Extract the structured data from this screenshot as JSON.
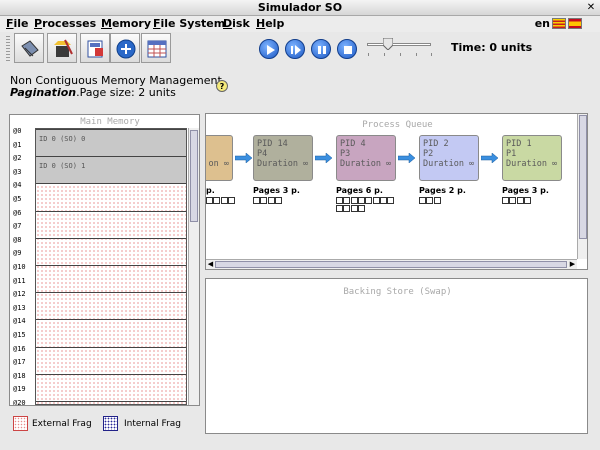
{
  "window": {
    "title": "Simulador SO"
  },
  "menubar": {
    "items": [
      {
        "label": "File",
        "mnemonic": "F"
      },
      {
        "label": "Processes",
        "mnemonic": "P"
      },
      {
        "label": "Memory",
        "mnemonic": "M"
      },
      {
        "label": "File System",
        "mnemonic": "F"
      },
      {
        "label": "Disk",
        "mnemonic": "D"
      },
      {
        "label": "Help",
        "mnemonic": "H"
      }
    ],
    "language": "en",
    "flags": [
      "catalan-flag",
      "spanish-flag"
    ]
  },
  "toolbar": {
    "tools": [
      "memory-config-icon",
      "clean-icon",
      "process-info-icon",
      "add-process-icon",
      "calendar-icon"
    ],
    "controls": [
      "play-icon",
      "step-icon",
      "pause-icon",
      "stop-icon"
    ],
    "speed_level": 0.33,
    "time": "Time: 0 units"
  },
  "mode": {
    "line1": "Non Contiguous Memory Management.",
    "line2_strong": "Pagination",
    "line2_rest": ".Page size: 2 units"
  },
  "memory": {
    "title": "Main Memory",
    "addresses": [
      "@0",
      "@1",
      "@2",
      "@3",
      "@4",
      "@5",
      "@6",
      "@7",
      "@8",
      "@9",
      "@10",
      "@11",
      "@12",
      "@13",
      "@14",
      "@15",
      "@16",
      "@17",
      "@18",
      "@19",
      "@20"
    ],
    "frames": [
      {
        "label": "ID 0 (SO) 0",
        "occupied": true
      },
      {
        "label": "ID 0 (SO) 1",
        "occupied": true
      },
      {
        "label": "",
        "occupied": false
      },
      {
        "label": "",
        "occupied": false
      },
      {
        "label": "",
        "occupied": false
      },
      {
        "label": "",
        "occupied": false
      },
      {
        "label": "",
        "occupied": false
      },
      {
        "label": "",
        "occupied": false
      },
      {
        "label": "",
        "occupied": false
      },
      {
        "label": "",
        "occupied": false
      },
      {
        "label": "",
        "occupied": false
      }
    ]
  },
  "legend": {
    "external": "External Frag",
    "internal": "Internal Frag"
  },
  "queue": {
    "title": "Process Queue",
    "processes": [
      {
        "line1": "",
        "line2": "",
        "line3": "on ∞",
        "color": "#ddc08f",
        "pages_label": "p.",
        "pages": 4
      },
      {
        "line1": "PID 14",
        "line2": "P4",
        "line3": "Duration ∞",
        "color": "#b0b09d",
        "pages_label": "Pages 3 p.",
        "pages": 4
      },
      {
        "line1": "PID 4",
        "line2": "P3",
        "line3": "Duration ∞",
        "color": "#c8a5c0",
        "pages_label": "Pages 6 p.",
        "pages": 12
      },
      {
        "line1": "PID 2",
        "line2": "P2",
        "line3": "Duration ∞",
        "color": "#c3c9f3",
        "pages_label": "Pages 2 p.",
        "pages": 3
      },
      {
        "line1": "PID 1",
        "line2": "P1",
        "line3": "Duration ∞",
        "color": "#c9d9a3",
        "pages_label": "Pages 3 p.",
        "pages": 4
      }
    ]
  },
  "swap": {
    "title": "Backing Store (Swap)"
  }
}
